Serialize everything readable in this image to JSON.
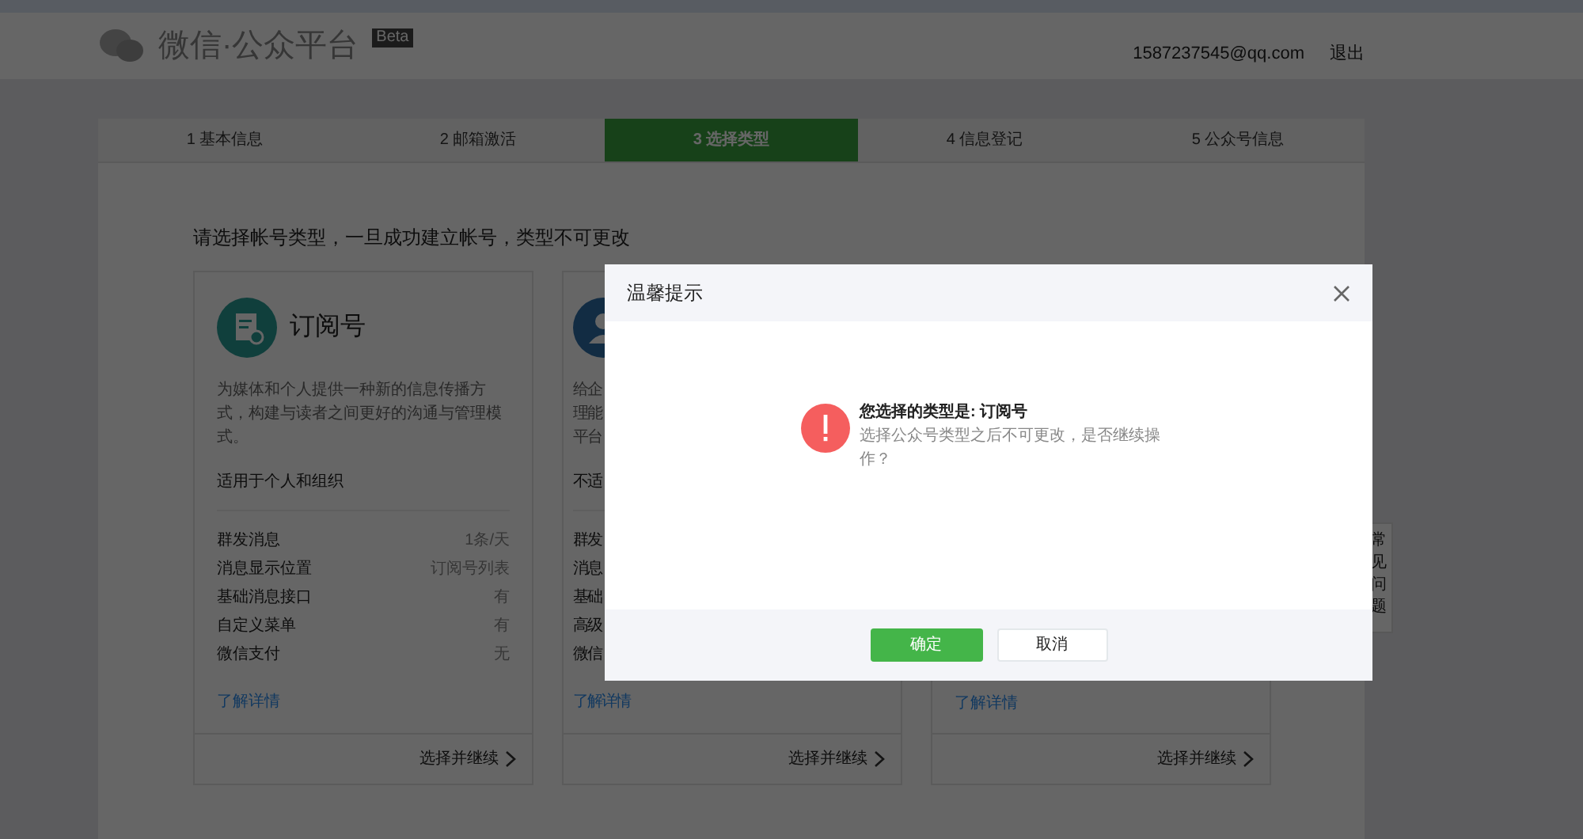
{
  "header": {
    "logo": "微信·公众平台",
    "badge": "Beta",
    "email": "1587237545@qq.com",
    "logout": "退出"
  },
  "steps": [
    {
      "label": "1 基本信息",
      "selected": false
    },
    {
      "label": "2 邮箱激活",
      "selected": false
    },
    {
      "label": "3 选择类型",
      "selected": true
    },
    {
      "label": "4 信息登记",
      "selected": false
    },
    {
      "label": "5 公众号信息",
      "selected": false
    }
  ],
  "prompt": "请选择帐号类型，一旦成功建立帐号，类型不可更改",
  "cards": [
    {
      "title": "订阅号",
      "desc_lines": [
        "为媒体和个人提供一种新的信息传播方式，构建与读者之间更好的沟通与管理模式。"
      ],
      "audience": "适用于个人和组织",
      "features": [
        {
          "label": "群发消息",
          "value": "1条/天"
        },
        {
          "label": "消息显示位置",
          "value": "订阅号列表"
        },
        {
          "label": "基础消息接口",
          "value": "有"
        },
        {
          "label": "自定义菜单",
          "value": "有"
        },
        {
          "label": "微信支付",
          "value": "无"
        }
      ],
      "link": "了解详情",
      "action": "选择并继续"
    },
    {
      "desc_lines": [
        "给企",
        "理能",
        "平台"
      ],
      "audience": "不适",
      "features": [
        {
          "label": "群发"
        },
        {
          "label": "消息"
        },
        {
          "label": "基础"
        },
        {
          "label": "高级"
        },
        {
          "label": "微信"
        }
      ],
      "link": "了解详情",
      "action": "选择并继续"
    },
    {
      "link": "了解详情",
      "action": "选择并继续"
    }
  ],
  "help": "常见问题",
  "dialog": {
    "title": "温馨提示",
    "heading": "您选择的类型是: 订阅号",
    "message": "选择公众号类型之后不可更改，是否继续操作？",
    "confirm": "确定",
    "cancel": "取消"
  }
}
